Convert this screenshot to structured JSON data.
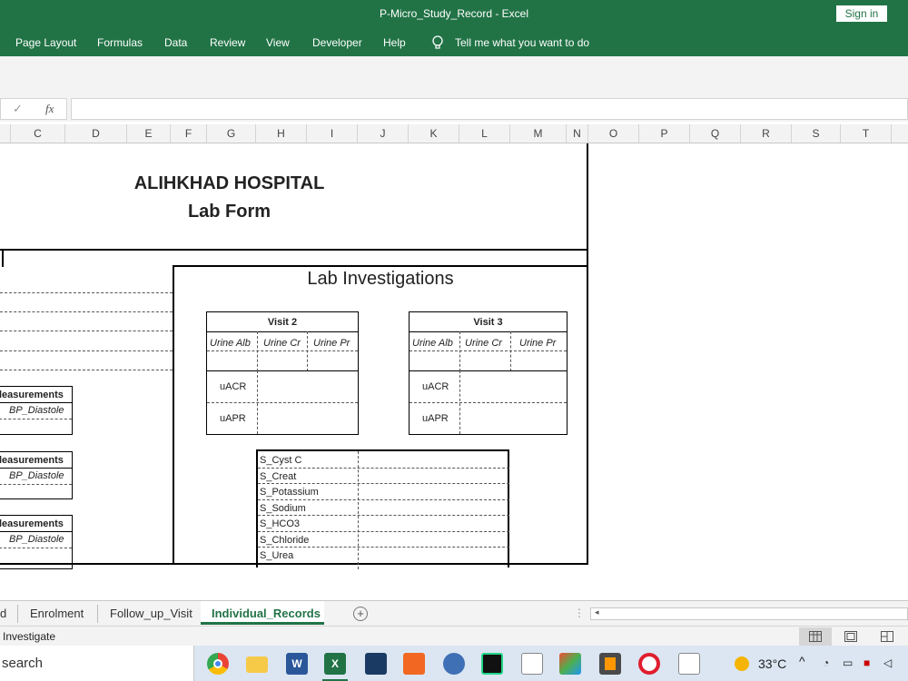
{
  "window": {
    "title": "P-Micro_Study_Record  -  Excel",
    "sign_in": "Sign in"
  },
  "ribbon_tabs": [
    "Page Layout",
    "Formulas",
    "Data",
    "Review",
    "View",
    "Developer",
    "Help"
  ],
  "tell_me": "Tell me what you want to do",
  "formula_bar": {
    "fx": "fx",
    "value": ""
  },
  "columns": [
    "C",
    "D",
    "E",
    "F",
    "G",
    "H",
    "I",
    "J",
    "K",
    "L",
    "M",
    "N",
    "O",
    "P",
    "Q",
    "R",
    "S",
    "T"
  ],
  "form": {
    "hospital": "ALIHKHAD HOSPITAL",
    "form_title": "Lab Form",
    "lab_title": "Lab Investigations",
    "measure_heading": "leasurements",
    "bp_diastole": "BP_Diastole",
    "visit2": {
      "title": "Visit 2",
      "cols": [
        "Urine Alb",
        "Urine Cr",
        "Urine Pr"
      ],
      "rows": [
        "uACR",
        "uAPR"
      ]
    },
    "visit3": {
      "title": "Visit 3",
      "cols": [
        "Urine Alb",
        "Urine Cr",
        "Urine Pr"
      ],
      "rows": [
        "uACR",
        "uAPR"
      ]
    },
    "serum": [
      "S_Cyst C",
      "S_Creat",
      "S_Potassium",
      "S_Sodium",
      "S_HCO3",
      "S_Chloride",
      "S_Urea"
    ]
  },
  "sheets": {
    "partial": "d",
    "items": [
      "Enrolment",
      "Follow_up_Visit",
      "Individual_Records"
    ],
    "active": "Individual_Records"
  },
  "status": {
    "text": "Investigate"
  },
  "taskbar": {
    "search": "search",
    "weather": "33°C"
  },
  "colors": {
    "excel_green": "#217346"
  }
}
